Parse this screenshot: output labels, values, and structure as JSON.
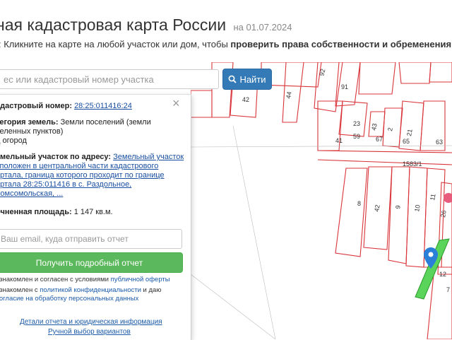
{
  "header": {
    "title": "ная кадастровая карта России",
    "date": "на 01.07.2024",
    "hint_prefix": ":  Кликните на карте на любой участок или дом, чтобы ",
    "hint_bold": "проверить права собственности и обременения",
    "hint_suffix": "."
  },
  "search": {
    "placeholder": "ес или кадастровый номер участка",
    "button_label": "Найти"
  },
  "panel": {
    "close_glyph": "×",
    "cadastral_label": "адастровый номер:",
    "cadastral_value": "28:25:011416:24",
    "category_label": "тегория земель:",
    "category_value_1": "Земли поселений (земли",
    "category_value_2": "селенных пунктов)",
    "category_value_3": "д огород",
    "address_label": "емельный участок по адресу:",
    "address_lines": [
      "Земельный участок",
      "сположен в центральной части кадастрового",
      "артала, граница которого проходит по границе",
      "артала 28:25:011416 в с. Раздольное,",
      "Комсомольская, ..."
    ],
    "area_label": "очненная площадь:",
    "area_value": "1 147 кв.м.",
    "email_placeholder": "Ваш email, куда отправить отчет",
    "report_button": "Получить подробный отчет",
    "consent1_prefix": "ознакомлен и согласен с условиями ",
    "consent1_link": "публичной оферты",
    "consent2_prefix": "ознакомлен с ",
    "consent2_link": "политикой конфиденциальности",
    "consent2_suffix": " и даю",
    "consent3_link": "согласие на обработку персональных данных",
    "details_link": "Детали отчета и юридическая информация",
    "manual_link": "Ручной выбор вариантов"
  },
  "map": {
    "parcel_labels": [
      "42",
      "92",
      "91",
      "44",
      "23",
      "59",
      "41",
      "67",
      "43",
      "2",
      "21",
      "65",
      "63",
      "1583/1",
      "8",
      "42",
      "9",
      "10",
      "11",
      "26",
      "12",
      "7",
      "Za"
    ],
    "selected_color": "#5bd45b",
    "boundary_color": "#d9343a",
    "marker_color": "#2a7fd8"
  }
}
